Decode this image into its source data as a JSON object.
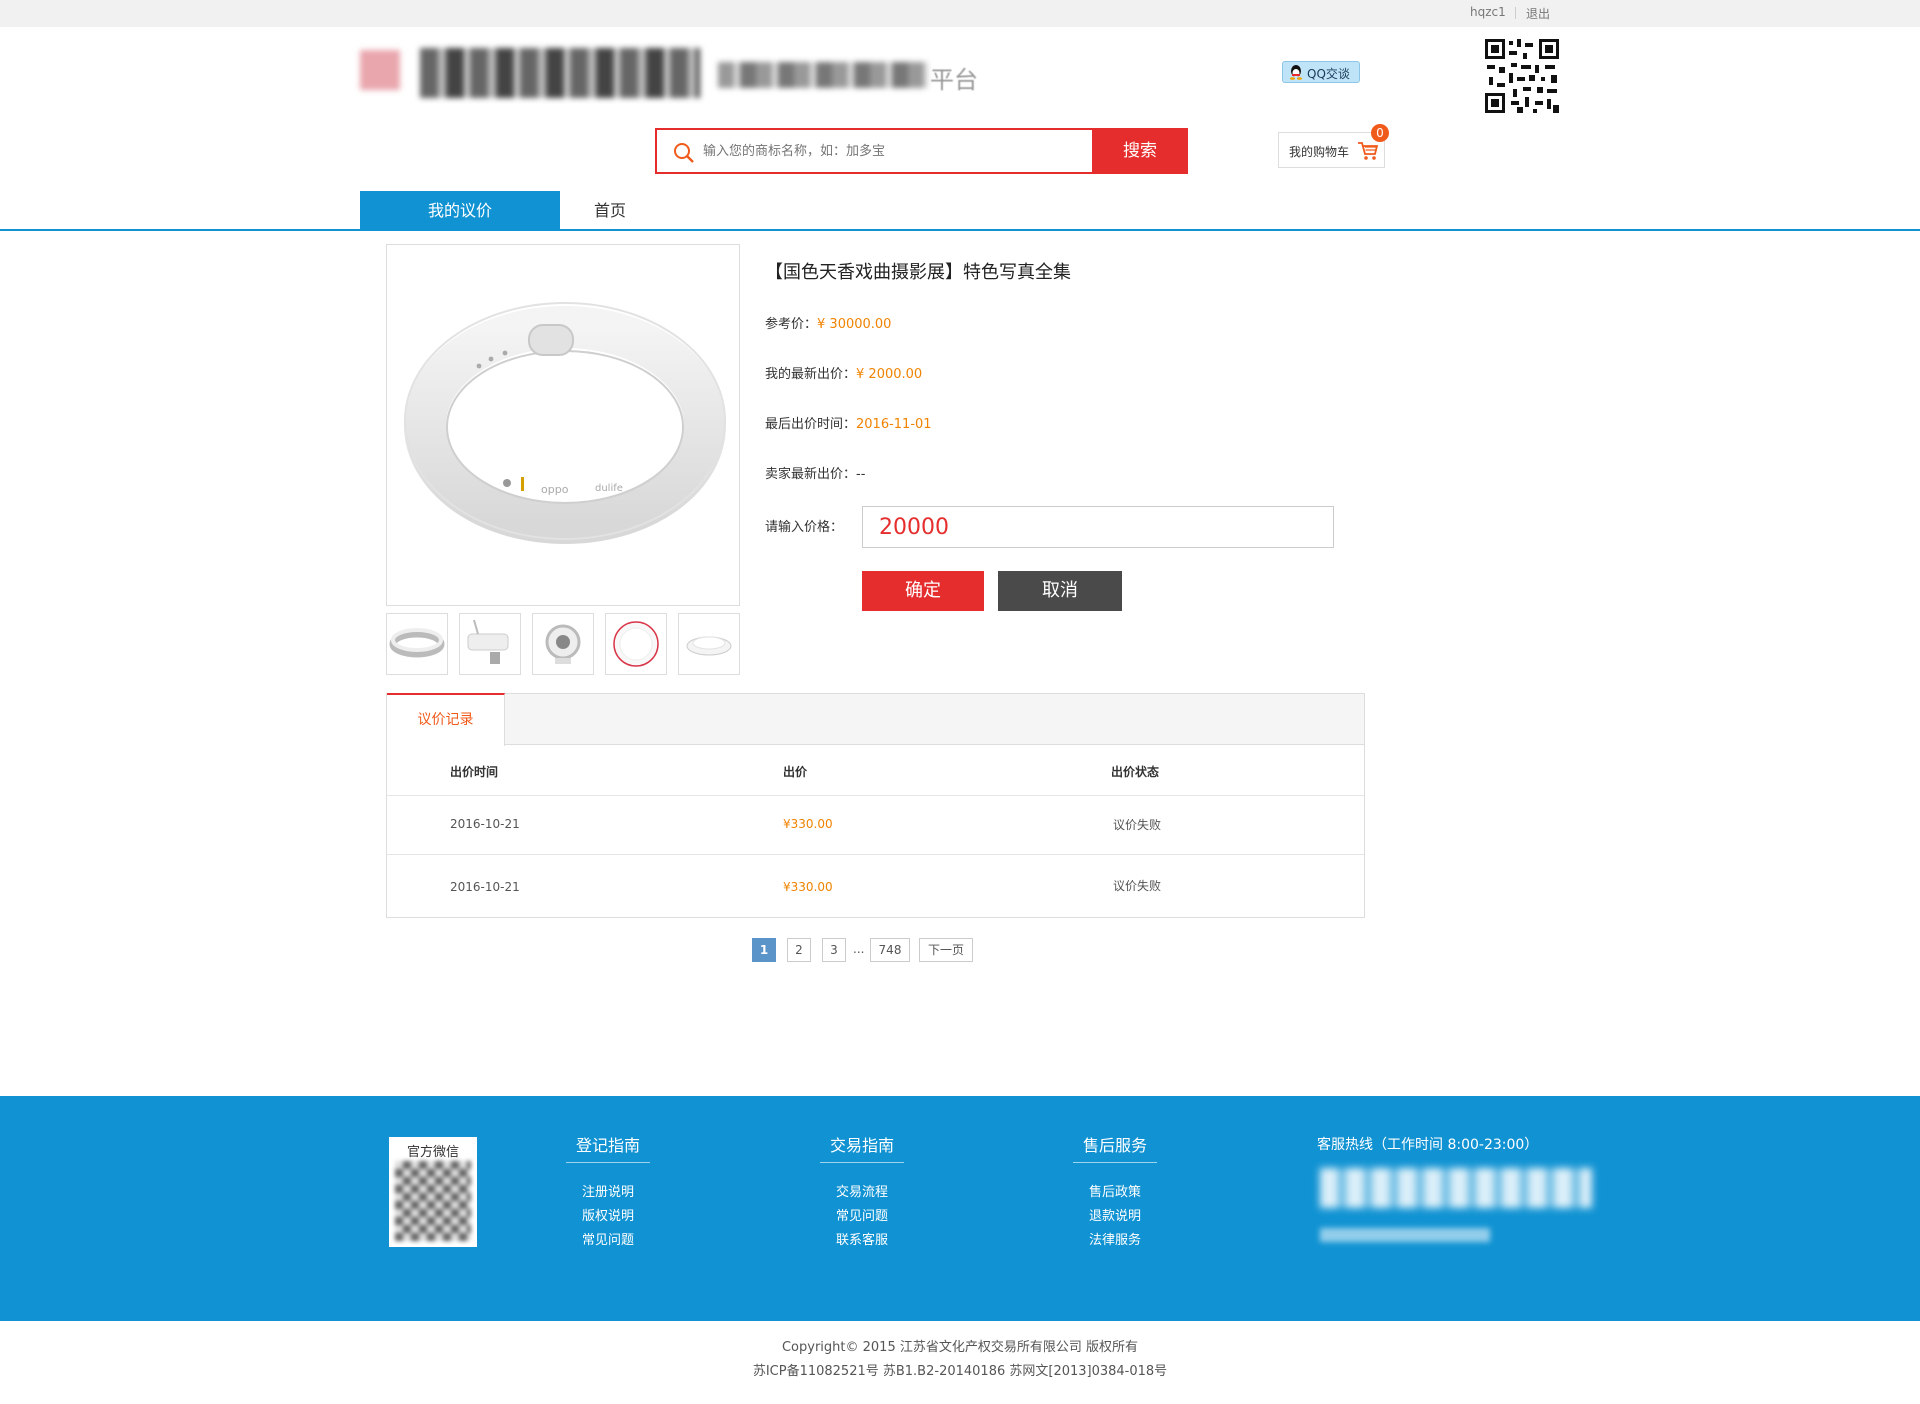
{
  "topbar": {
    "username": "hqzc1",
    "logout": "退出"
  },
  "header": {
    "logo_suffix": "平台",
    "qq_button": "QQ交谈",
    "search_placeholder": "输入您的商标名称，如：加多宝",
    "search_button": "搜索",
    "cart_label": "我的购物车",
    "cart_count": "0"
  },
  "nav": {
    "tabs": [
      {
        "label": "我的议价",
        "active": true
      },
      {
        "label": "首页",
        "active": false
      }
    ]
  },
  "product": {
    "title": "【国色天香戏曲摄影展】特色写真全集",
    "reference_price_label": "参考价：",
    "reference_price": "¥ 30000.00",
    "my_latest_bid_label": "我的最新出价：",
    "my_latest_bid": "¥ 2000.00",
    "last_bid_time_label": "最后出价时间：",
    "last_bid_time": "2016-11-01",
    "seller_latest_bid_label": "卖家最新出价：",
    "seller_latest_bid": "--",
    "price_input_label": "请输入价格：",
    "price_input_value": "20000",
    "confirm_button": "确定",
    "cancel_button": "取消"
  },
  "records": {
    "tab_label": "议价记录",
    "columns": [
      "出价时间",
      "出价",
      "出价状态"
    ],
    "rows": [
      {
        "time": "2016-10-21",
        "price": "¥330.00",
        "status": "议价失败"
      },
      {
        "time": "2016-10-21",
        "price": "¥330.00",
        "status": "议价失败"
      }
    ]
  },
  "pagination": {
    "pages": [
      "1",
      "2",
      "3"
    ],
    "ellipsis": "...",
    "last_page": "748",
    "next": "下一页",
    "current": 1
  },
  "footer": {
    "wechat_label": "官方微信",
    "columns": [
      {
        "title": "登记指南",
        "links": [
          "注册说明",
          "版权说明",
          "常见问题"
        ]
      },
      {
        "title": "交易指南",
        "links": [
          "交易流程",
          "常见问题",
          "联系客服"
        ]
      },
      {
        "title": "售后服务",
        "links": [
          "售后政策",
          "退款说明",
          "法律服务"
        ]
      }
    ],
    "hotline_label": "客服热线（工作时间 8:00-23:00）",
    "copyright_line1": "Copyright© 2015 江苏省文化产权交易所有限公司 版权所有",
    "copyright_line2": "苏ICP备11082521号 苏B1.B2-20140186 苏网文[2013]0384-018号"
  },
  "colors": {
    "brand_blue": "#1193d3",
    "accent_red": "#e52d2d",
    "price_orange": "#f08300",
    "cancel_gray": "#4a4a4a"
  }
}
